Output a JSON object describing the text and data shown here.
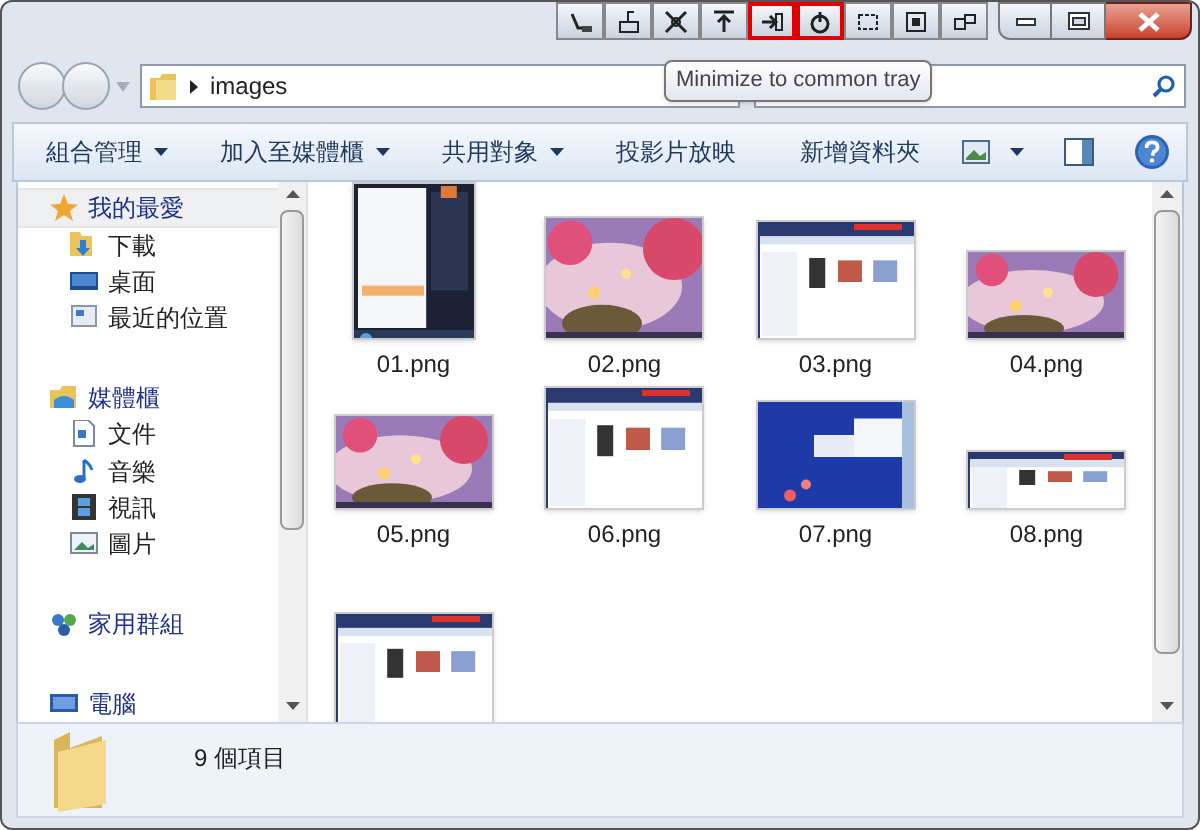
{
  "tray_buttons": [
    {
      "highlighted": false
    },
    {
      "highlighted": false
    },
    {
      "highlighted": false
    },
    {
      "highlighted": false
    },
    {
      "highlighted": true
    },
    {
      "highlighted": true
    },
    {
      "highlighted": false
    },
    {
      "highlighted": false
    },
    {
      "highlighted": false
    }
  ],
  "tooltip": "Minimize to common tray",
  "address": {
    "path": "images"
  },
  "toolbar": [
    {
      "label": "組合管理",
      "dropdown": true
    },
    {
      "label": "加入至媒體櫃",
      "dropdown": true
    },
    {
      "label": "共用對象",
      "dropdown": true
    },
    {
      "label": "投影片放映",
      "dropdown": false
    },
    {
      "label": "新增資料夾",
      "dropdown": false
    }
  ],
  "sidebar": {
    "items": [
      {
        "label": "我的最愛",
        "selected": true,
        "children": [
          {
            "label": "下載"
          },
          {
            "label": "桌面"
          },
          {
            "label": "最近的位置"
          }
        ]
      },
      {
        "label": "媒體櫃",
        "selected": false,
        "children": [
          {
            "label": "文件"
          },
          {
            "label": "音樂"
          },
          {
            "label": "視訊"
          },
          {
            "label": "圖片"
          }
        ]
      },
      {
        "label": "家用群組",
        "selected": false
      },
      {
        "label": "電腦",
        "selected": false
      }
    ]
  },
  "files": [
    {
      "kind": "picture",
      "name": "01.png"
    },
    {
      "kind": "picture",
      "name": "02.png"
    },
    {
      "kind": "picture",
      "name": "03.png"
    },
    {
      "kind": "picture",
      "name": "04.png"
    },
    {
      "kind": "picture",
      "name": "05.png"
    },
    {
      "kind": "picture",
      "name": "06.png"
    },
    {
      "kind": "picture",
      "name": "07.png"
    },
    {
      "kind": "picture",
      "name": "08.png"
    },
    {
      "kind": "picture"
    }
  ],
  "status_bar": {
    "count": "9 個項目"
  }
}
